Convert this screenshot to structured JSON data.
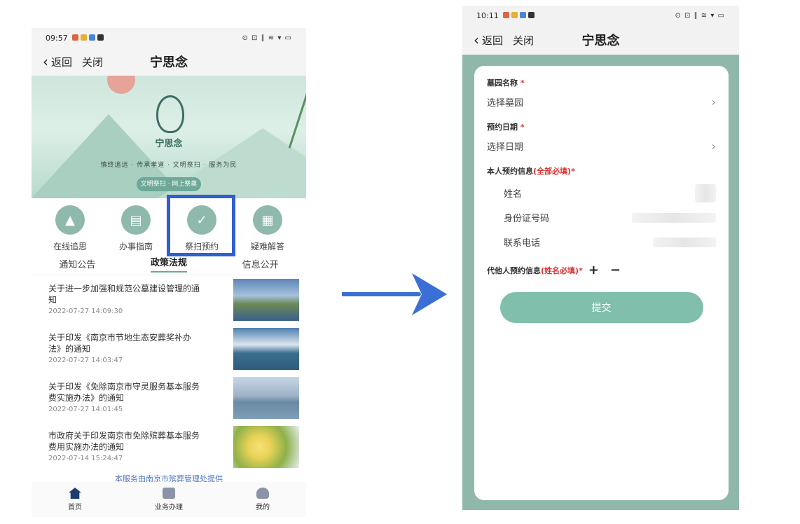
{
  "left_screen": {
    "status": {
      "time": "09:57",
      "right_icons": "⊙ ⊡ ∥ ≋ ▾ ▭"
    },
    "nav": {
      "back_label": "返回",
      "close_label": "关闭",
      "title": "宁思念"
    },
    "banner": {
      "logo_text": "宁思念",
      "slogan": "慎终追远 · 传承孝道 · 文明祭扫 · 服务为民",
      "pill_label": "文明祭扫 · 网上祭奠"
    },
    "quick_icons": [
      {
        "label": "在线追思"
      },
      {
        "label": "办事指南"
      },
      {
        "label": "祭扫预约"
      },
      {
        "label": "疑难解答"
      }
    ],
    "tabs": [
      {
        "label": "通知公告"
      },
      {
        "label": "政策法规"
      },
      {
        "label": "信息公开"
      }
    ],
    "news": [
      {
        "title": "关于进一步加强和规范公墓建设管理的通知",
        "date": "2022-07-27 14:09:30"
      },
      {
        "title": "关于印发《南京市节地生态安葬奖补办法》的通知",
        "date": "2022-07-27 14:03:47"
      },
      {
        "title": "关于印发《免除南京市守灵服务基本服务费实施办法》的通知",
        "date": "2022-07-27 14:01:45"
      },
      {
        "title": "市政府关于印发南京市免除殡葬基本服务费用实施办法的通知",
        "date": "2022-07-14 15:24:47"
      }
    ],
    "footer_note": "本服务由南京市殡葬管理处提供",
    "bottom_nav": [
      {
        "label": "首页"
      },
      {
        "label": "业务办理"
      },
      {
        "label": "我的"
      }
    ]
  },
  "right_screen": {
    "status": {
      "time": "10:11",
      "right_icons": "⊙ ⊡ ∥ ≋ ▾ ▭"
    },
    "nav": {
      "back_label": "返回",
      "close_label": "关闭",
      "title": "宁思念"
    },
    "form": {
      "cemetery_label": "墓园名称",
      "cemetery_placeholder": "选择墓园",
      "date_label": "预约日期",
      "date_placeholder": "选择日期",
      "self_info_title": "本人预约信息",
      "self_info_hint": "(全部必填)",
      "name_label": "姓名",
      "id_label": "身份证号码",
      "phone_label": "联系电话",
      "proxy_title": "代他人预约信息",
      "proxy_hint": "(姓名必填)",
      "add_symbol": "+",
      "remove_symbol": "−",
      "submit_label": "提交"
    }
  }
}
